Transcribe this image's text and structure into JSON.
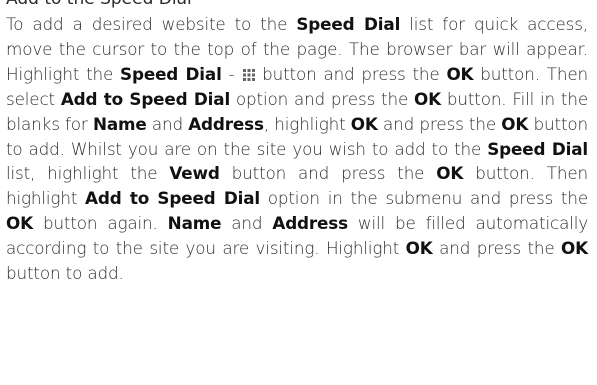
{
  "heading_partial": "Add to the Speed Dial",
  "paragraph": {
    "t1": "To add a desired website to the ",
    "b1": "Speed Dial",
    "t2": " list for quick access, move the cursor to the top of the page. The browser bar will appear. Highlight the ",
    "b2": "Speed Dial",
    "t3": " - ",
    "icon_name": "speed-dial-grid-icon",
    "t4": " button and press the ",
    "b3": "OK",
    "t5": " button. Then select ",
    "b4": "Add to Speed Dial",
    "t6": " option and press the ",
    "b5": "OK",
    "t7": " button. Fill in the blanks for ",
    "b6": "Name",
    "t8": " and ",
    "b7": "Address",
    "t9": ", highlight ",
    "b8": "OK",
    "t10": " and press the ",
    "b9": "OK",
    "t11": " button to add. Whilst you are on the site you wish to add to the ",
    "b10": "Speed Dial",
    "t12": " list, highlight the ",
    "b11": "Vewd",
    "t13": " button and press the ",
    "b12": "OK",
    "t14": " button. Then highlight ",
    "b13": "Add to Speed Dial",
    "t15": " option in the submenu and press the ",
    "b14": "OK",
    "t16": " button again. ",
    "b15": "Name",
    "t17": " and ",
    "b16": "Address",
    "t18": " will be filled automatically according to the site you are visiting. Highlight ",
    "b17": "OK",
    "t19": " and press the ",
    "b18": "OK",
    "t20": " button to add."
  },
  "colors": {
    "text": "#2d2d2d",
    "bold_text": "#111111",
    "icon": "#666666"
  }
}
